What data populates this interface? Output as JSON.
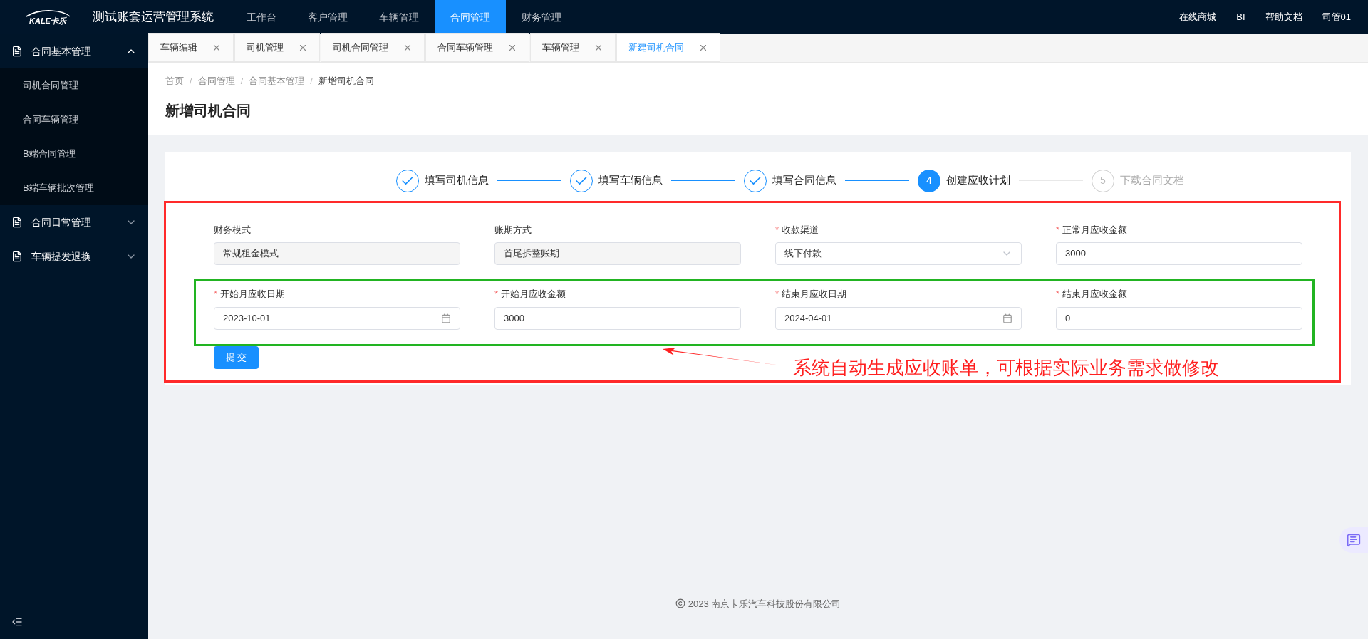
{
  "app": {
    "logo_text": "KALE卡乐",
    "title": "测试账套运营管理系统"
  },
  "nav": [
    {
      "label": "工作台",
      "selected": false
    },
    {
      "label": "客户管理",
      "selected": false
    },
    {
      "label": "车辆管理",
      "selected": false
    },
    {
      "label": "合同管理",
      "selected": true
    },
    {
      "label": "财务管理",
      "selected": false
    }
  ],
  "top_links": [
    "在线商城",
    "BI",
    "帮助文档",
    "司管01"
  ],
  "sidebar": [
    {
      "label": "合同基本管理",
      "expanded": true,
      "children": [
        {
          "label": "司机合同管理"
        },
        {
          "label": "合同车辆管理"
        },
        {
          "label": "B端合同管理"
        },
        {
          "label": "B端车辆批次管理"
        }
      ]
    },
    {
      "label": "合同日常管理",
      "expanded": false
    },
    {
      "label": "车辆提发退换",
      "expanded": false
    }
  ],
  "tabs": [
    {
      "label": "车辆编辑",
      "selected": false
    },
    {
      "label": "司机管理",
      "selected": false
    },
    {
      "label": "司机合同管理",
      "selected": false
    },
    {
      "label": "合同车辆管理",
      "selected": false
    },
    {
      "label": "车辆管理",
      "selected": false
    },
    {
      "label": "新建司机合同",
      "selected": true
    }
  ],
  "breadcrumb": [
    {
      "label": "首页",
      "separator": "/"
    },
    {
      "label": "合同管理",
      "separator": "/"
    },
    {
      "label": "合同基本管理",
      "separator": "/"
    },
    {
      "label": "新增司机合同"
    }
  ],
  "page_title": "新增司机合同",
  "steps": [
    {
      "label": "填写司机信息",
      "done": true,
      "active": false
    },
    {
      "label": "填写车辆信息",
      "done": true,
      "active": false
    },
    {
      "label": "填写合同信息",
      "done": true,
      "active": false
    },
    {
      "number": "4",
      "label": "创建应收计划",
      "done": false,
      "active": true
    },
    {
      "number": "5",
      "label": "下载合同文档",
      "done": false,
      "active": false
    }
  ],
  "form_rows": [
    {
      "highlighted": false,
      "fields": [
        {
          "label": "财务模式",
          "kind": "readonly",
          "value": "常规租金模式"
        },
        {
          "label": "账期方式",
          "kind": "readonly",
          "value": "首尾拆整账期"
        },
        {
          "label": "收款渠道",
          "required_mark": "*",
          "kind": "select",
          "value": "线下付款"
        },
        {
          "label": "正常月应收金额",
          "required_mark": "*",
          "kind": "text",
          "value": "3000"
        }
      ]
    },
    {
      "highlighted": true,
      "fields": [
        {
          "label": "开始月应收日期",
          "required_mark": "*",
          "kind": "date",
          "value": "2023-10-01"
        },
        {
          "label": "开始月应收金额",
          "required_mark": "*",
          "kind": "text",
          "value": "3000"
        },
        {
          "label": "结束月应收日期",
          "required_mark": "*",
          "kind": "date",
          "value": "2024-04-01"
        },
        {
          "label": "结束月应收金额",
          "required_mark": "*",
          "kind": "text",
          "value": "0"
        }
      ]
    }
  ],
  "submit_label": "提 交",
  "annotation": "系统自动生成应收账单，可根据实际业务需求做修改",
  "footer": "2023 南京卡乐汽车科技股份有限公司"
}
